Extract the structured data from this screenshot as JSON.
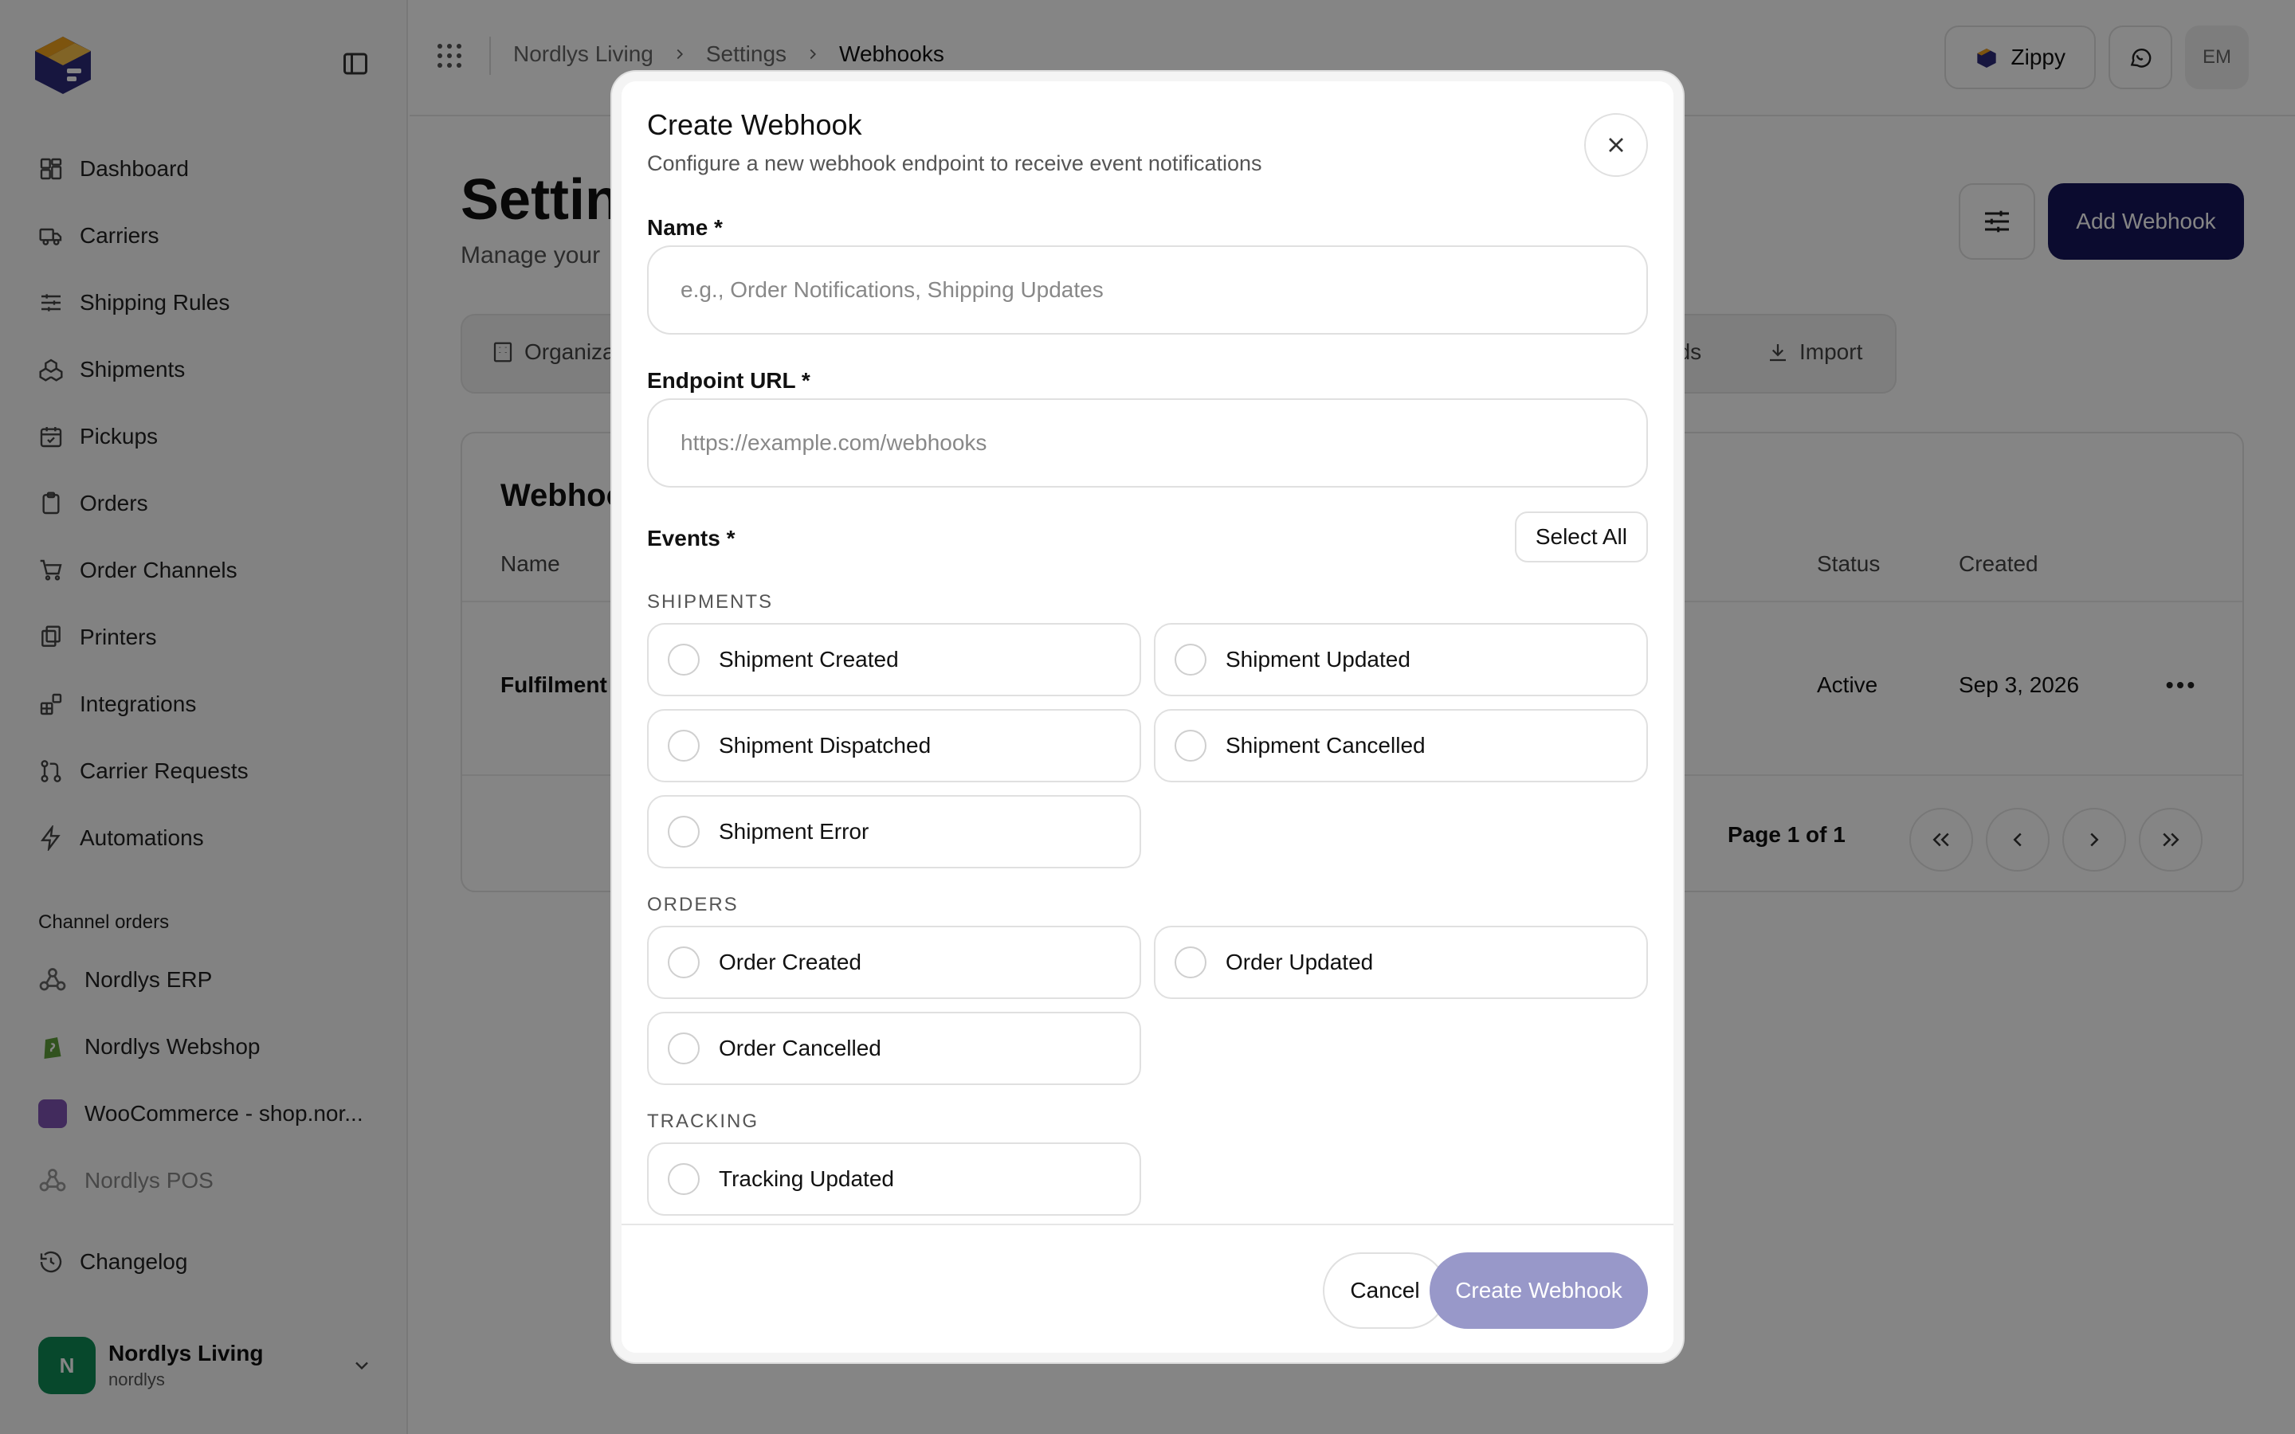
{
  "breadcrumb": {
    "org": "Nordlys Living",
    "settings": "Settings",
    "current": "Webhooks"
  },
  "topbar": {
    "brand": "Zippy",
    "initials": "EM"
  },
  "sidebar": {
    "items": [
      {
        "label": "Dashboard",
        "icon": "dashboard-icon"
      },
      {
        "label": "Carriers",
        "icon": "truck-icon"
      },
      {
        "label": "Shipping Rules",
        "icon": "sliders-icon"
      },
      {
        "label": "Shipments",
        "icon": "boxes-icon"
      },
      {
        "label": "Pickups",
        "icon": "calendar-check-icon"
      },
      {
        "label": "Orders",
        "icon": "clipboard-icon"
      },
      {
        "label": "Order Channels",
        "icon": "cart-icon"
      },
      {
        "label": "Printers",
        "icon": "printer-icon"
      },
      {
        "label": "Integrations",
        "icon": "blocks-icon"
      },
      {
        "label": "Carrier Requests",
        "icon": "git-pull-icon"
      },
      {
        "label": "Automations",
        "icon": "bolt-icon"
      }
    ],
    "section_label": "Channel orders",
    "channels": [
      {
        "label": "Nordlys ERP"
      },
      {
        "label": "Nordlys Webshop"
      },
      {
        "label": "WooCommerce - shop.nor..."
      },
      {
        "label": "Nordlys POS"
      }
    ],
    "changelog": "Changelog",
    "user": {
      "initial": "N",
      "name": "Nordlys Living",
      "handle": "nordlys"
    }
  },
  "page": {
    "title": "Settin",
    "subtitle": "Manage your",
    "add_button": "Add Webhook",
    "tabs": {
      "organization": "Organiza",
      "brands": "nds",
      "import": "Import"
    },
    "card": {
      "title": "Webhoo",
      "columns": {
        "name": "Name",
        "status": "Status",
        "created": "Created"
      },
      "row": {
        "name": "Fulfilment r",
        "status": "Active",
        "created": "Sep 3, 2026"
      },
      "pager": "Page 1 of 1"
    }
  },
  "modal": {
    "title": "Create Webhook",
    "subtitle": "Configure a new webhook endpoint to receive event notifications",
    "name_label": "Name *",
    "name_placeholder": "e.g., Order Notifications, Shipping Updates",
    "url_label": "Endpoint URL *",
    "url_placeholder": "https://example.com/webhooks",
    "events_label": "Events *",
    "select_all": "Select All",
    "groups": {
      "shipments": "SHIPMENTS",
      "orders": "ORDERS",
      "tracking": "TRACKING"
    },
    "events": {
      "shipment_created": "Shipment Created",
      "shipment_updated": "Shipment Updated",
      "shipment_dispatched": "Shipment Dispatched",
      "shipment_cancelled": "Shipment Cancelled",
      "shipment_error": "Shipment Error",
      "order_created": "Order Created",
      "order_updated": "Order Updated",
      "order_cancelled": "Order Cancelled",
      "tracking_updated": "Tracking Updated"
    },
    "cancel": "Cancel",
    "create": "Create Webhook"
  },
  "colors": {
    "primary": "#16165a",
    "primary_disabled": "#9898c9",
    "success": "#0e8a55"
  }
}
